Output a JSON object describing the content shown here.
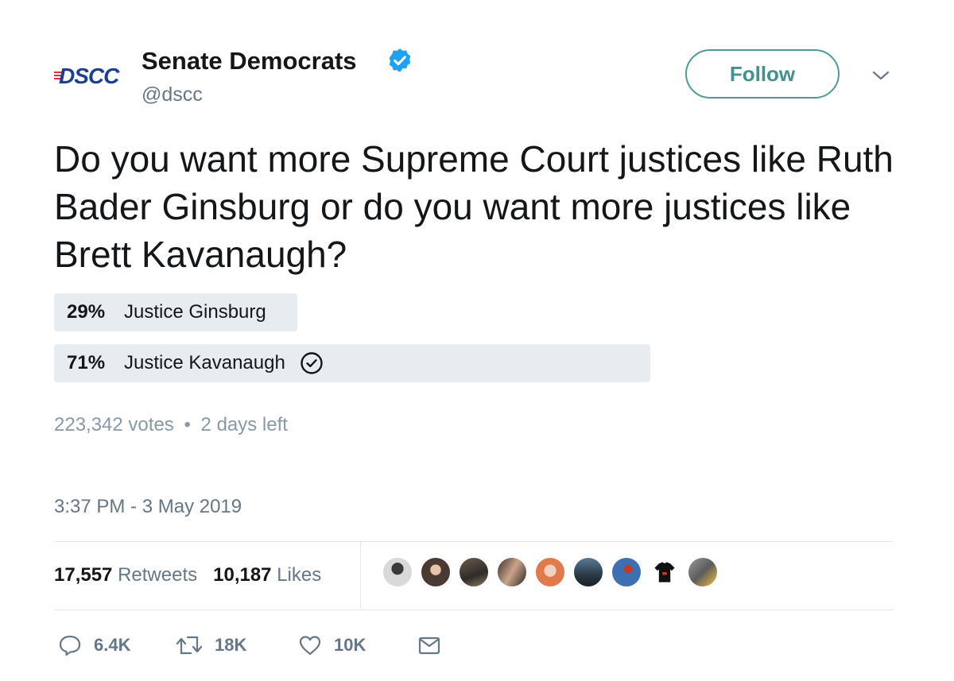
{
  "account": {
    "logo_text": "DSCC",
    "name": "Senate Democrats",
    "handle": "@dscc",
    "follow_label": "Follow"
  },
  "tweet": {
    "text": "Do you want more Supreme Court justices like Ruth Bader Ginsburg or do you want more justices like Brett Kavanaugh?"
  },
  "poll": {
    "options": [
      {
        "percent_label": "29%",
        "label": "Justice Ginsburg",
        "fraction": 0.29
      },
      {
        "percent_label": "71%",
        "label": "Justice Kavanaugh",
        "fraction": 0.71
      }
    ],
    "votes": "223,342 votes",
    "separator": "•",
    "time_left": "2 days left"
  },
  "timestamp": "3:37 PM - 3 May 2019",
  "stats": {
    "retweets_count": "17,557",
    "retweets_label": "Retweets",
    "likes_count": "10,187",
    "likes_label": "Likes"
  },
  "actions": {
    "replies": "6.4K",
    "retweets": "18K",
    "likes": "10K"
  },
  "colors": {
    "accent": "#43908f",
    "verified": "#1da1f2",
    "poll_fill": "#e6ecf0",
    "muted": "#657786"
  }
}
